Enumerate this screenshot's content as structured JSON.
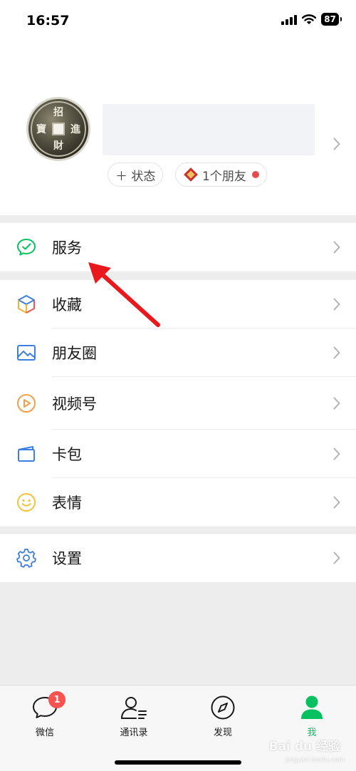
{
  "status_bar": {
    "time": "16:57",
    "battery": "87"
  },
  "profile": {
    "status_chip": "＋ 状态",
    "friends_chip": "1个朋友",
    "avatar_icon": "coin-avatar-icon"
  },
  "menu": {
    "services": "服务",
    "favorites": "收藏",
    "moments": "朋友圈",
    "channels": "视频号",
    "cards": "卡包",
    "stickers": "表情",
    "settings": "设置"
  },
  "tabs": [
    {
      "label": "微信",
      "icon": "chat-bubble-icon",
      "badge": "1"
    },
    {
      "label": "通讯录",
      "icon": "contacts-icon"
    },
    {
      "label": "发现",
      "icon": "compass-icon"
    },
    {
      "label": "我",
      "icon": "person-icon",
      "active": true
    }
  ],
  "colors": {
    "accent": "#07c160",
    "badge": "#fa5151",
    "annotation_arrow": "#e8181c"
  },
  "watermark": {
    "main": "Bai du 经验",
    "sub": "jingyan.baidu.com"
  }
}
